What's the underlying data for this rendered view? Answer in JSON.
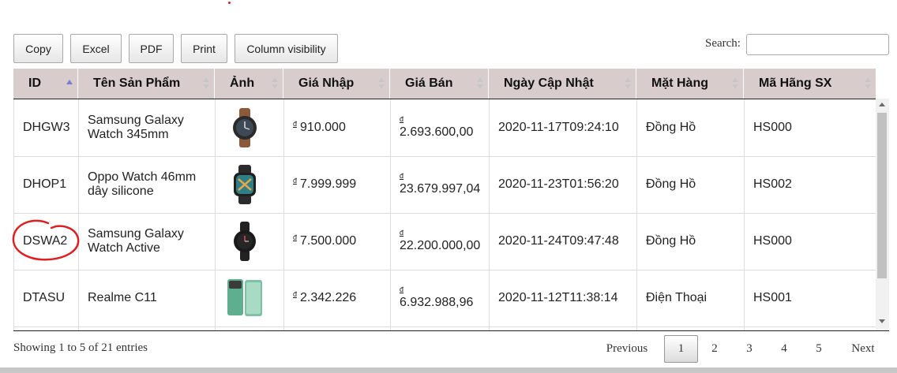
{
  "toolbar": {
    "buttons": [
      "Copy",
      "Excel",
      "PDF",
      "Print",
      "Column visibility"
    ]
  },
  "search": {
    "label": "Search:",
    "value": ""
  },
  "table": {
    "columns": [
      "ID",
      "Tên Sản Phẩm",
      "Ảnh",
      "Giá Nhập",
      "Giá Bán",
      "Ngày Cập Nhật",
      "Mặt Hàng",
      "Mã Hãng SX"
    ],
    "currency_symbol": "đ",
    "rows": [
      {
        "id": "DHGW3",
        "name": "Samsung Galaxy Watch 345mm",
        "image": "watch-icon",
        "import_price": "910.000",
        "sale_price": "2.693.600,00",
        "updated": "2020-11-17T09:24:10",
        "category": "Đồng Hồ",
        "manufacturer": "HS000"
      },
      {
        "id": "DHOP1",
        "name": "Oppo Watch 46mm dây silicone",
        "image": "watch-icon",
        "import_price": "7.999.999",
        "sale_price": "23.679.997,04",
        "updated": "2020-11-23T01:56:20",
        "category": "Đồng Hồ",
        "manufacturer": "HS002"
      },
      {
        "id": "DSWA2",
        "name": "Samsung Galaxy Watch Active",
        "image": "watch-icon",
        "import_price": "7.500.000",
        "sale_price": "22.200.000,00",
        "updated": "2020-11-24T09:47:48",
        "category": "Đồng Hồ",
        "manufacturer": "HS000"
      },
      {
        "id": "DTASU",
        "name": "Realme C11",
        "image": "phone-icon",
        "import_price": "2.342.226",
        "sale_price": "6.932.988,96",
        "updated": "2020-11-12T11:38:14",
        "category": "Điện Thoại",
        "manufacturer": "HS001"
      }
    ]
  },
  "footer": {
    "info": "Showing 1 to 5 of 21 entries",
    "previous": "Previous",
    "pages": [
      "1",
      "2",
      "3",
      "4",
      "5"
    ],
    "current_page": "1",
    "next": "Next"
  },
  "colors": {
    "header_bg": "#d9cccc",
    "annotation": "#e02020",
    "sort_active": "#7b7bd8"
  }
}
